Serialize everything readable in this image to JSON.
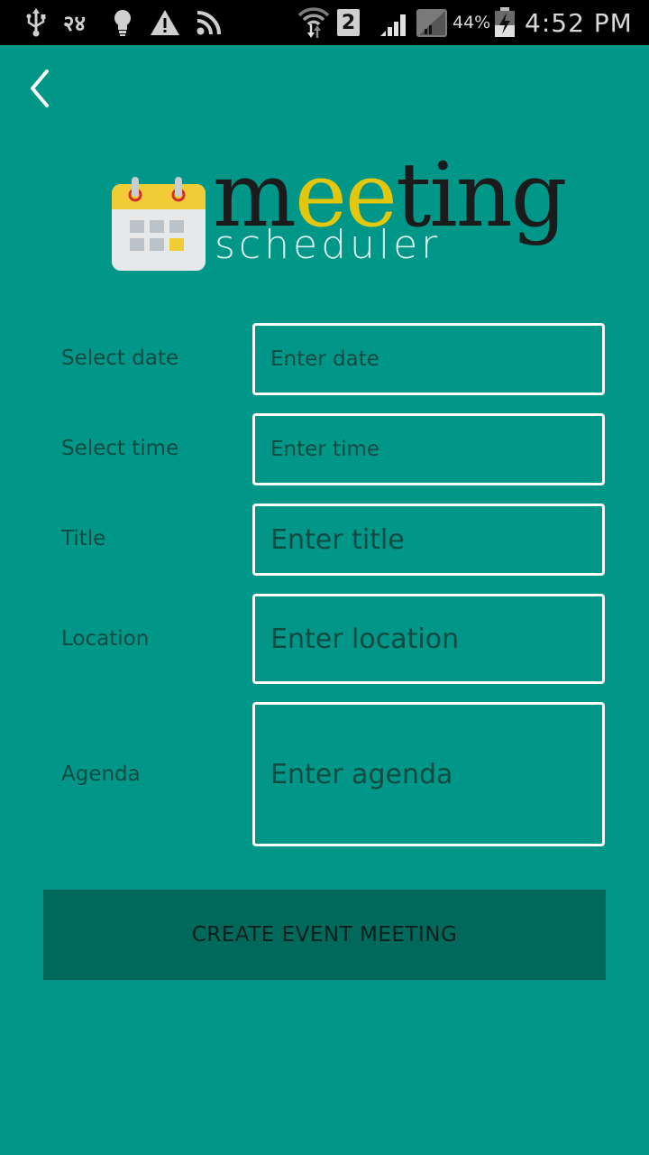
{
  "status_bar": {
    "left_icons": [
      "usb-icon",
      "notification-24-icon",
      "lightbulb-icon",
      "warning-icon",
      "rss-icon"
    ],
    "notification_number": "२४",
    "wifi": "wifi-icon",
    "sim_badge": "2",
    "battery_percent": "44%",
    "time": "4:52 PM"
  },
  "header": {
    "back_icon": "chevron-left-icon"
  },
  "logo": {
    "word_part1": "m",
    "word_yellow": "ee",
    "word_part2": "ting",
    "subtitle": "scheduler",
    "colors": {
      "yellow": "#e2c70e",
      "dark": "#1b1b1b",
      "calendar_top": "#f0cd36",
      "calendar_ring": "#d32f2f"
    }
  },
  "form": {
    "fields": [
      {
        "label": "Select date",
        "placeholder": "Enter date",
        "value": ""
      },
      {
        "label": "Select time",
        "placeholder": "Enter time",
        "value": ""
      },
      {
        "label": "Title",
        "placeholder": "Enter title",
        "value": ""
      },
      {
        "label": "Location",
        "placeholder": "Enter location",
        "value": ""
      },
      {
        "label": "Agenda",
        "placeholder": "Enter agenda",
        "value": ""
      }
    ]
  },
  "actions": {
    "create_label": "CREATE EVENT MEETING"
  },
  "colors": {
    "background": "#009688",
    "button": "#00695c",
    "text_dark": "#124a43",
    "field_border": "#ffffff"
  }
}
